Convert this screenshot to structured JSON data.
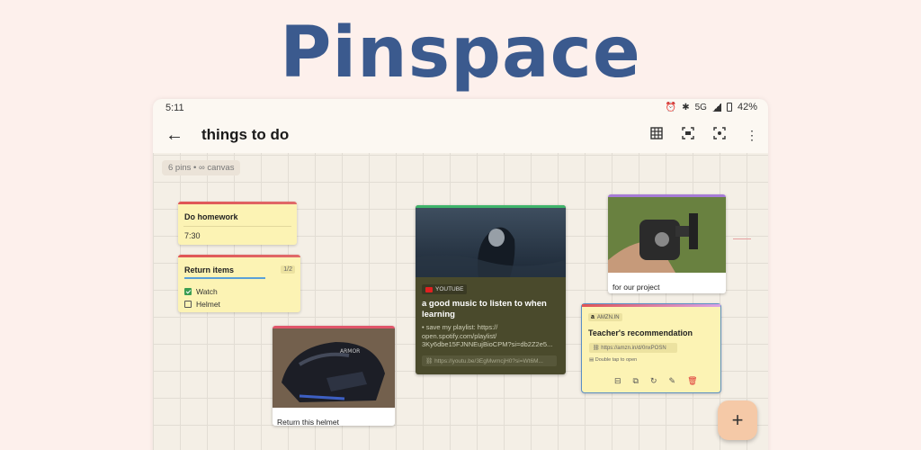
{
  "promo": {
    "title": "Pinspace"
  },
  "status_bar": {
    "time": "5:11",
    "network": "5G",
    "battery": "42%"
  },
  "app_bar": {
    "title": "things to do",
    "icons": [
      "back-arrow-icon",
      "grid-icon",
      "fit-screen-icon",
      "center-focus-icon",
      "more-vert-icon"
    ]
  },
  "canvas": {
    "info_chip": "6 pins • ∞ canvas"
  },
  "pins": {
    "homework": {
      "title": "Do homework",
      "time": "7:30",
      "accent": "#e05555"
    },
    "return_items": {
      "title": "Return items",
      "count": "1/2",
      "progress": 0.5,
      "items": [
        {
          "label": "Watch",
          "checked": true
        },
        {
          "label": "Helmet",
          "checked": false
        }
      ]
    },
    "helmet": {
      "caption": "Return this helmet",
      "accent": "#e0566a"
    },
    "music": {
      "source": "YOUTUBE",
      "title": "a good music to listen to when learning",
      "description": "• save my playlist: https:// open.spotify.com/playlist/ 3Ky6dbe15FJNNEujBioCPM?si=db2Z2e5...",
      "link": "https://youtu.be/3EgMwmcjH0?si=Wt6M..."
    },
    "project": {
      "caption": "for our project",
      "accent": "#a67bd6"
    },
    "teacher": {
      "source": "AMZN.IN",
      "title": "Teacher's recommendation",
      "link": "https://amzn.in/d/0nxPOSN",
      "hint": "Double tap to open",
      "tools": [
        "archive-icon",
        "copy-icon",
        "refresh-icon",
        "edit-icon",
        "delete-icon"
      ]
    }
  },
  "fab": {
    "label": "+"
  }
}
